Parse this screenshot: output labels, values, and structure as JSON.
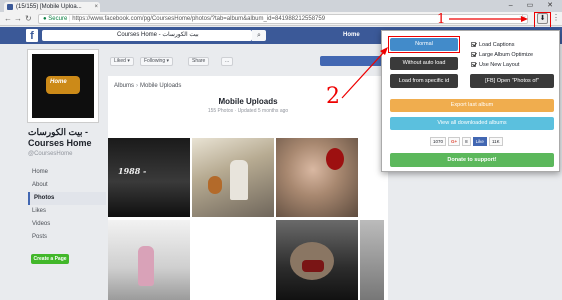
{
  "browser": {
    "tab_title": "(15/155) [Mobile Uploa...",
    "tab_close": "×",
    "window_controls": "– ▭ ✕",
    "secure_label": "Secure",
    "url": "https://www.facebook.com/pg/CoursesHome/photos/?tab=album&album_id=841988212558759"
  },
  "fb_header": {
    "logo": "f",
    "search_value": "Courses Home - بيت الكورسات",
    "home_label": "Home"
  },
  "page": {
    "name_arabic": "بيت الكورسات -",
    "name": "Courses Home",
    "handle": "@CoursesHome",
    "logo_text": "Home",
    "nav": [
      "Home",
      "About",
      "Photos",
      "Likes",
      "Videos",
      "Posts"
    ],
    "active_nav": "Photos",
    "create_page_label": "Create a Page",
    "actions": {
      "liked": "Liked ▾",
      "following": "Following ▾",
      "share": "Share",
      "more": "..."
    }
  },
  "album": {
    "breadcrumb_root": "Albums",
    "breadcrumb_sep": "›",
    "breadcrumb_current": "Mobile Uploads",
    "title": "Mobile Uploads",
    "meta": "155 Photos · Updated 5 months ago",
    "photo1_caption": "1988 - "
  },
  "popup": {
    "normal": "Normal",
    "without_auto_load": "Without auto load",
    "load_from_specific": "Load from specific id",
    "fb_open": "[FB] Open \"Photos of\"",
    "export_last": "Export last album",
    "view_all": "View all downloaded albums",
    "donate": "Donate to support!",
    "options": [
      {
        "label": "Load Captions",
        "checked": true
      },
      {
        "label": "Large Album Optimize",
        "checked": true
      },
      {
        "label": "Use New Layout",
        "checked": true
      }
    ],
    "share": {
      "count1": "1070",
      "gplus": "G+",
      "count2": "8",
      "fb_like": "Like",
      "count3": "11K"
    }
  },
  "annotations": {
    "step1": "1",
    "step2": "2",
    "color": "#ee0000"
  },
  "colors": {
    "fb_blue": "#3b5998",
    "normal_btn": "#428bca",
    "export_btn": "#f0ad4e",
    "view_btn": "#5bc0de",
    "donate_btn": "#5cb85c"
  }
}
